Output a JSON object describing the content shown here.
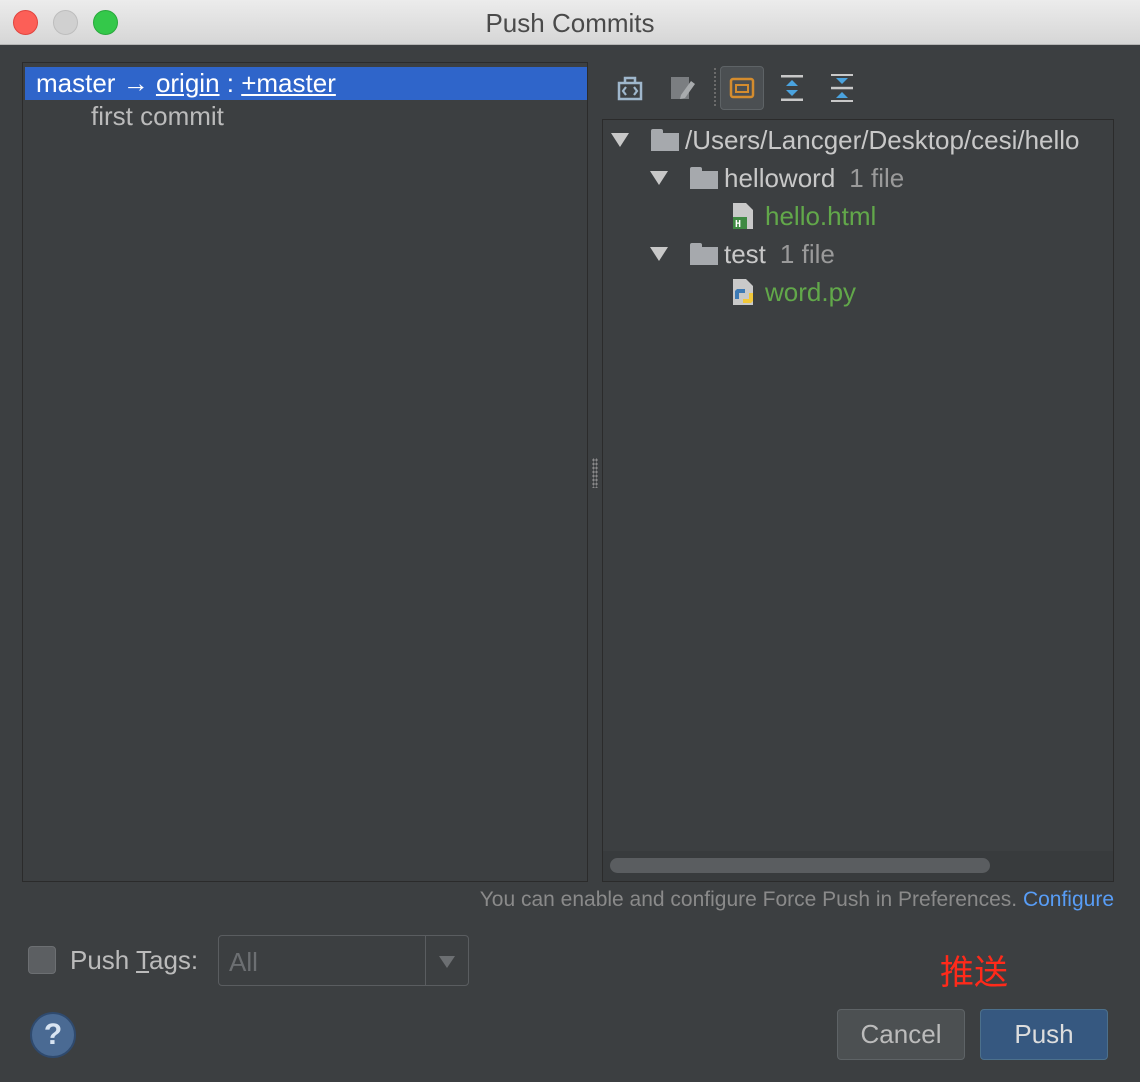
{
  "window": {
    "title": "Push Commits"
  },
  "left": {
    "branch": {
      "local": "master",
      "arrow": "→",
      "remote": "origin",
      "sep": " : ",
      "target": "+master"
    },
    "commits": [
      {
        "message": "first commit"
      }
    ]
  },
  "toolbar": {
    "icons": [
      "show-diff-icon",
      "edit-source-icon",
      "group-by-directory-icon",
      "expand-all-icon",
      "collapse-all-icon"
    ]
  },
  "tree": {
    "root": "/Users/Lancger/Desktop/cesi/hello",
    "dirs": [
      {
        "name": "helloword",
        "count": "1 file",
        "files": [
          {
            "name": "hello.html",
            "icon": "html-file-icon"
          }
        ]
      },
      {
        "name": "test",
        "count": "1 file",
        "files": [
          {
            "name": "word.py",
            "icon": "python-file-icon"
          }
        ]
      }
    ]
  },
  "hint": {
    "text": "You can enable and configure Force Push in Preferences. ",
    "link": "Configure"
  },
  "push_tags": {
    "label_pre": "Push ",
    "label_mn": "T",
    "label_post": "ags:",
    "value": "All",
    "checked": false
  },
  "annotation": "推送",
  "buttons": {
    "help": "?",
    "cancel": "Cancel",
    "push": "Push"
  },
  "colors": {
    "accent": "#2f65ca",
    "file_added": "#62a84a",
    "link": "#589df6",
    "annotation": "#ff2a1a"
  }
}
